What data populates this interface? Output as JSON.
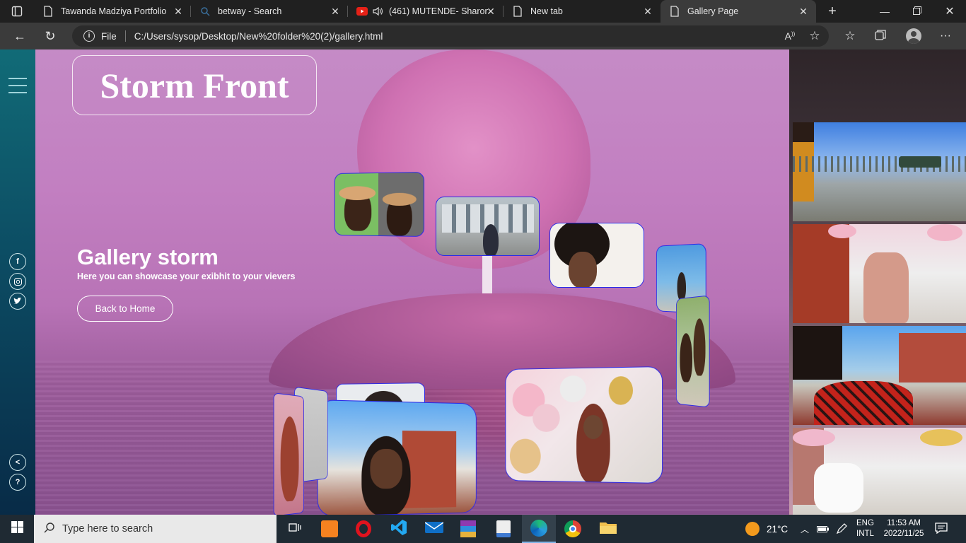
{
  "browser": {
    "tabs": [
      {
        "label": "Tawanda Madziya Portfolio",
        "icon": "page-icon"
      },
      {
        "label": "betway - Search",
        "icon": "search-icon"
      },
      {
        "label": "(461) MUTENDE- Sharon",
        "icon": "youtube-icon"
      },
      {
        "label": "New tab",
        "icon": "page-icon"
      },
      {
        "label": "Gallery Page",
        "icon": "page-icon"
      }
    ],
    "address": {
      "scheme_label": "File",
      "url": "C:/Users/sysop/Desktop/New%20folder%20(2)/gallery.html"
    }
  },
  "page": {
    "logo": "Storm Front",
    "hero_title": "Gallery storm",
    "hero_subtitle": "Here you can showcase your exibhit to your vievers",
    "back_button": "Back to Home",
    "social_icons": [
      "facebook-icon",
      "instagram-icon",
      "twitter-icon"
    ]
  },
  "taskbar": {
    "search_placeholder": "Type here to search",
    "weather": "21°C",
    "language_top": "ENG",
    "language_bottom": "INTL",
    "time": "11:53 AM",
    "date": "2022/11/25"
  }
}
